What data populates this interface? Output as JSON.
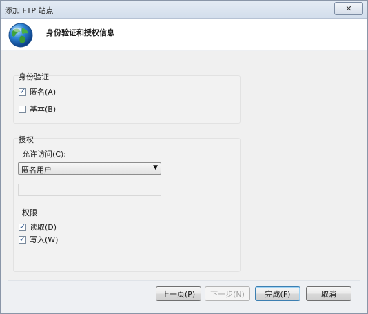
{
  "window": {
    "title": "添加 FTP 站点",
    "close_glyph": "✕"
  },
  "header": {
    "title": "身份验证和授权信息",
    "icon": "globe-icon"
  },
  "authentication": {
    "label": "身份验证",
    "anonymous": {
      "label": "匿名(A)",
      "checked": true
    },
    "basic": {
      "label": "基本(B)",
      "checked": false
    }
  },
  "authorization": {
    "label": "授权",
    "allow_access_label": "允许访问(C):",
    "allow_access_value": "匿名用户",
    "user_field_value": "",
    "permissions": {
      "label": "权限",
      "read": {
        "label": "读取(D)",
        "checked": true
      },
      "write": {
        "label": "写入(W)",
        "checked": true
      }
    }
  },
  "buttons": {
    "previous": "上一页(P)",
    "next": "下一步(N)",
    "finish": "完成(F)",
    "cancel": "取消"
  }
}
